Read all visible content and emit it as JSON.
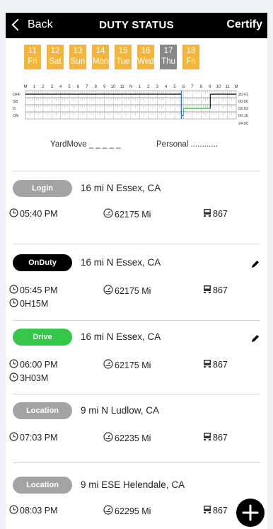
{
  "header": {
    "back_label": "Back",
    "title": "DUTY STATUS",
    "certify_label": "Certify"
  },
  "days": [
    {
      "num": "11",
      "dow": "Fri"
    },
    {
      "num": "12",
      "dow": "Sat"
    },
    {
      "num": "13",
      "dow": "Sun"
    },
    {
      "num": "14",
      "dow": "Mon"
    },
    {
      "num": "15",
      "dow": "Tue"
    },
    {
      "num": "16",
      "dow": "Wed"
    },
    {
      "num": "17",
      "dow": "Thu"
    },
    {
      "num": "18",
      "dow": "Fri"
    }
  ],
  "graph": {
    "hour_labels": [
      "M",
      "1",
      "2",
      "3",
      "4",
      "5",
      "6",
      "7",
      "8",
      "9",
      "10",
      "11",
      "N",
      "1",
      "2",
      "3",
      "4",
      "5",
      "6",
      "7",
      "8",
      "9",
      "10",
      "11",
      "M"
    ],
    "rows": [
      "OFF",
      "SB",
      "D",
      "ON"
    ],
    "totals": [
      "20:41",
      "00:00",
      "03:03",
      "00:15"
    ],
    "grand_total": "24:00",
    "log_entries": [
      {
        "status": "OFF",
        "start": "00:00",
        "end": "17:45"
      },
      {
        "status": "ON",
        "start": "17:45",
        "end": "18:00"
      },
      {
        "status": "D",
        "start": "18:00",
        "end": "21:03"
      },
      {
        "status": "OFF",
        "start": "21:03",
        "end": "24:00"
      }
    ]
  },
  "legend": {
    "yard_move": "YardMove _ _ _ _ _",
    "personal": "Personal ............"
  },
  "events": [
    {
      "status": "Login",
      "location": "16 mi N Essex, CA",
      "time": "05:40 PM",
      "odometer": "62175 Mi",
      "vehicle": "867",
      "duration": "",
      "editable": false
    },
    {
      "status": "OnDuty",
      "location": "16 mi N Essex, CA",
      "time": "05:45 PM",
      "odometer": "62175 Mi",
      "vehicle": "867",
      "duration": "0H15M",
      "editable": true
    },
    {
      "status": "Drive",
      "location": "16 mi N Essex, CA",
      "time": "06:00 PM",
      "odometer": "62175 Mi",
      "vehicle": "867",
      "duration": "3H03M",
      "editable": true
    },
    {
      "status": "Location",
      "location": "9 mi N Ludlow, CA",
      "time": "07:03 PM",
      "odometer": "62235 Mi",
      "vehicle": "867",
      "duration": "",
      "editable": false
    },
    {
      "status": "Location",
      "location": "9 mi ESE Helendale, CA",
      "time": "08:03 PM",
      "odometer": "62295 Mi",
      "vehicle": "867",
      "duration": "",
      "editable": false
    }
  ],
  "colors": {
    "day_tab": "#f4b63a",
    "day_tab_active": "#888888",
    "drive_green": "#35c64a",
    "onduty_black": "#000000",
    "neutral_grey": "#a3a3a3",
    "graph_blue": "#2f6fd6"
  }
}
